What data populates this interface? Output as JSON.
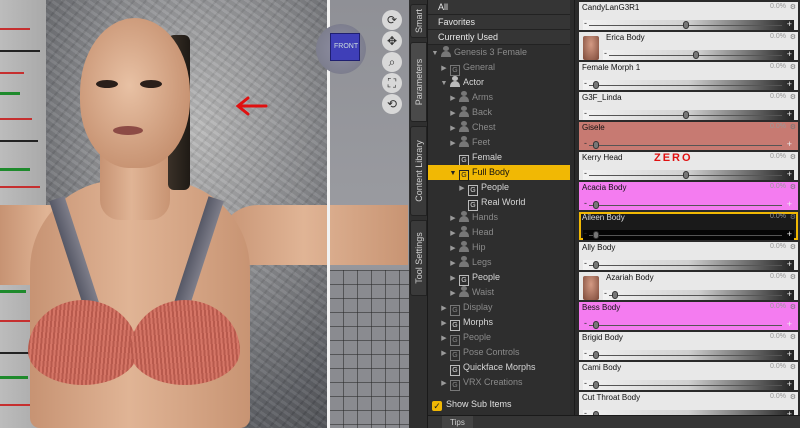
{
  "viewport": {
    "annotation_color": "#e01010",
    "tools": [
      "rotate-icon",
      "move-icon",
      "zoom-icon",
      "frame-icon",
      "reset-icon"
    ]
  },
  "tabs": [
    "Smart",
    "Parameters",
    "Content Library",
    "Tool Settings"
  ],
  "tree": {
    "top_items": [
      "All",
      "Favorites",
      "Currently Used"
    ],
    "rows": [
      {
        "label": "Genesis 3 Female",
        "exp": "▼",
        "icon": "person",
        "dim": true,
        "indent": 0
      },
      {
        "label": "General",
        "exp": "▶",
        "icon": "g",
        "dim": true,
        "indent": 1
      },
      {
        "label": "Actor",
        "exp": "▼",
        "icon": "person",
        "dim": false,
        "indent": 1
      },
      {
        "label": "Arms",
        "exp": "▶",
        "icon": "person",
        "dim": true,
        "indent": 2
      },
      {
        "label": "Back",
        "exp": "▶",
        "icon": "person",
        "dim": true,
        "indent": 2
      },
      {
        "label": "Chest",
        "exp": "▶",
        "icon": "person",
        "dim": true,
        "indent": 2
      },
      {
        "label": "Feet",
        "exp": "▶",
        "icon": "person",
        "dim": true,
        "indent": 2
      },
      {
        "label": "Female",
        "exp": "",
        "icon": "g",
        "dim": false,
        "indent": 2
      },
      {
        "label": "Full Body",
        "exp": "▼",
        "icon": "g",
        "dim": false,
        "indent": 2,
        "selected": true
      },
      {
        "label": "People",
        "exp": "▶",
        "icon": "g",
        "dim": false,
        "indent": 3
      },
      {
        "label": "Real World",
        "exp": "",
        "icon": "g",
        "dim": false,
        "indent": 3
      },
      {
        "label": "Hands",
        "exp": "▶",
        "icon": "person",
        "dim": true,
        "indent": 2
      },
      {
        "label": "Head",
        "exp": "▶",
        "icon": "person",
        "dim": true,
        "indent": 2
      },
      {
        "label": "Hip",
        "exp": "▶",
        "icon": "person",
        "dim": true,
        "indent": 2
      },
      {
        "label": "Legs",
        "exp": "▶",
        "icon": "person",
        "dim": true,
        "indent": 2
      },
      {
        "label": "People",
        "exp": "▶",
        "icon": "g",
        "dim": false,
        "indent": 2
      },
      {
        "label": "Waist",
        "exp": "▶",
        "icon": "person",
        "dim": true,
        "indent": 2
      },
      {
        "label": "Display",
        "exp": "▶",
        "icon": "g",
        "dim": true,
        "indent": 1
      },
      {
        "label": "Morphs",
        "exp": "▶",
        "icon": "g",
        "dim": false,
        "indent": 1
      },
      {
        "label": "People",
        "exp": "▶",
        "icon": "g",
        "dim": true,
        "indent": 1
      },
      {
        "label": "Pose Controls",
        "exp": "▶",
        "icon": "g",
        "dim": true,
        "indent": 1
      },
      {
        "label": "Quickface Morphs",
        "exp": "",
        "icon": "g",
        "dim": false,
        "indent": 1
      },
      {
        "label": "VRX Creations",
        "exp": "▶",
        "icon": "g",
        "dim": true,
        "indent": 1
      }
    ],
    "show_sub_items": "Show Sub Items"
  },
  "sliders": [
    {
      "label": "CandyLanG3R1",
      "value": "0.0%",
      "bg": "#e8e8e8",
      "knob": 0.5,
      "thumb": false
    },
    {
      "label": "Erica Body",
      "value": "0.0%",
      "bg": "#e8e8e8",
      "knob": 0.5,
      "thumb": true
    },
    {
      "label": "Female Morph 1",
      "value": "0.0%",
      "bg": "#e8e8e8",
      "knob": 0.02,
      "thumb": false
    },
    {
      "label": "G3F_Linda",
      "value": "0.0%",
      "bg": "#e8e8e8",
      "knob": 0.5,
      "thumb": false
    },
    {
      "label": "Gisele",
      "value": "0.0%",
      "bg": "#c77a72",
      "knob": 0.02,
      "thumb": false
    },
    {
      "label": "Kerry Head",
      "value": "0.0%",
      "bg": "#e8e8e8",
      "knob": 0.5,
      "thumb": false
    },
    {
      "label": "Acacia Body",
      "value": "0.0%",
      "bg": "#f47cf0",
      "knob": 0.02,
      "thumb": false
    },
    {
      "label": "Aileen Body",
      "value": "0.0%",
      "bg": "#1a1a1a",
      "knob": 0.02,
      "thumb": false,
      "selected": true
    },
    {
      "label": "Ally Body",
      "value": "0.0%",
      "bg": "#e8e8e8",
      "knob": 0.02,
      "thumb": false
    },
    {
      "label": "Azariah Body",
      "value": "0.0%",
      "bg": "#e8e8e8",
      "knob": 0.02,
      "thumb": true
    },
    {
      "label": "Bess Body",
      "value": "0.0%",
      "bg": "#f47cf0",
      "knob": 0.02,
      "thumb": false
    },
    {
      "label": "Brigid Body",
      "value": "0.0%",
      "bg": "#e8e8e8",
      "knob": 0.02,
      "thumb": false
    },
    {
      "label": "Cami Body",
      "value": "0.0%",
      "bg": "#e8e8e8",
      "knob": 0.02,
      "thumb": false
    },
    {
      "label": "Cut Throat Body",
      "value": "0.0%",
      "bg": "#e8e8e8",
      "knob": 0.02,
      "thumb": false
    }
  ],
  "annotation_zero": "ZERO",
  "tips_tab": "Tips",
  "colors": {
    "accent": "#f1b804",
    "pink": "#f47cf0",
    "gisele": "#c77a72"
  }
}
